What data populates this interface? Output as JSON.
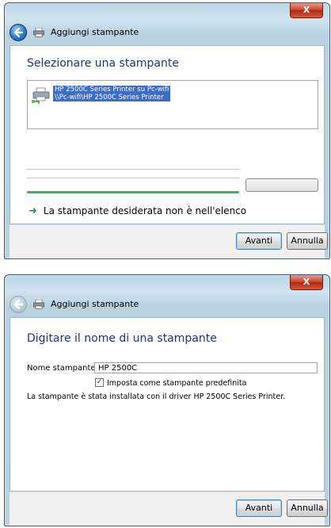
{
  "window1": {
    "close_label": "X",
    "title": "Aggiungi stampante",
    "heading": "Selezionare una stampante",
    "printer_list": [
      {
        "name": "HP 2500C Series Printer su Pc-wifi",
        "path": "\\\\Pc-wifi\\HP 2500C Series Printer"
      }
    ],
    "not_listed_link": "La stampante desiderata non è nell'elenco",
    "buttons": {
      "next": "Avanti",
      "cancel": "Annulla"
    }
  },
  "window2": {
    "close_label": "X",
    "title": "Aggiungi stampante",
    "heading": "Digitare il nome di una stampante",
    "name_label": "Nome stampante:",
    "name_value": "HP 2500C",
    "default_checkbox_label": "Imposta come stampante predefinita",
    "default_checked": true,
    "info": "La stampante è stata installata con il driver HP 2500C Series Printer.",
    "buttons": {
      "next": "Avanti",
      "cancel": "Annulla"
    }
  },
  "icons": [
    "back-arrow-icon",
    "printer-icon",
    "close-icon",
    "green-arrow-icon"
  ],
  "colors": {
    "heading": "#1e3287",
    "selection": "#3a6cc9",
    "progress": "#3fb64a"
  }
}
